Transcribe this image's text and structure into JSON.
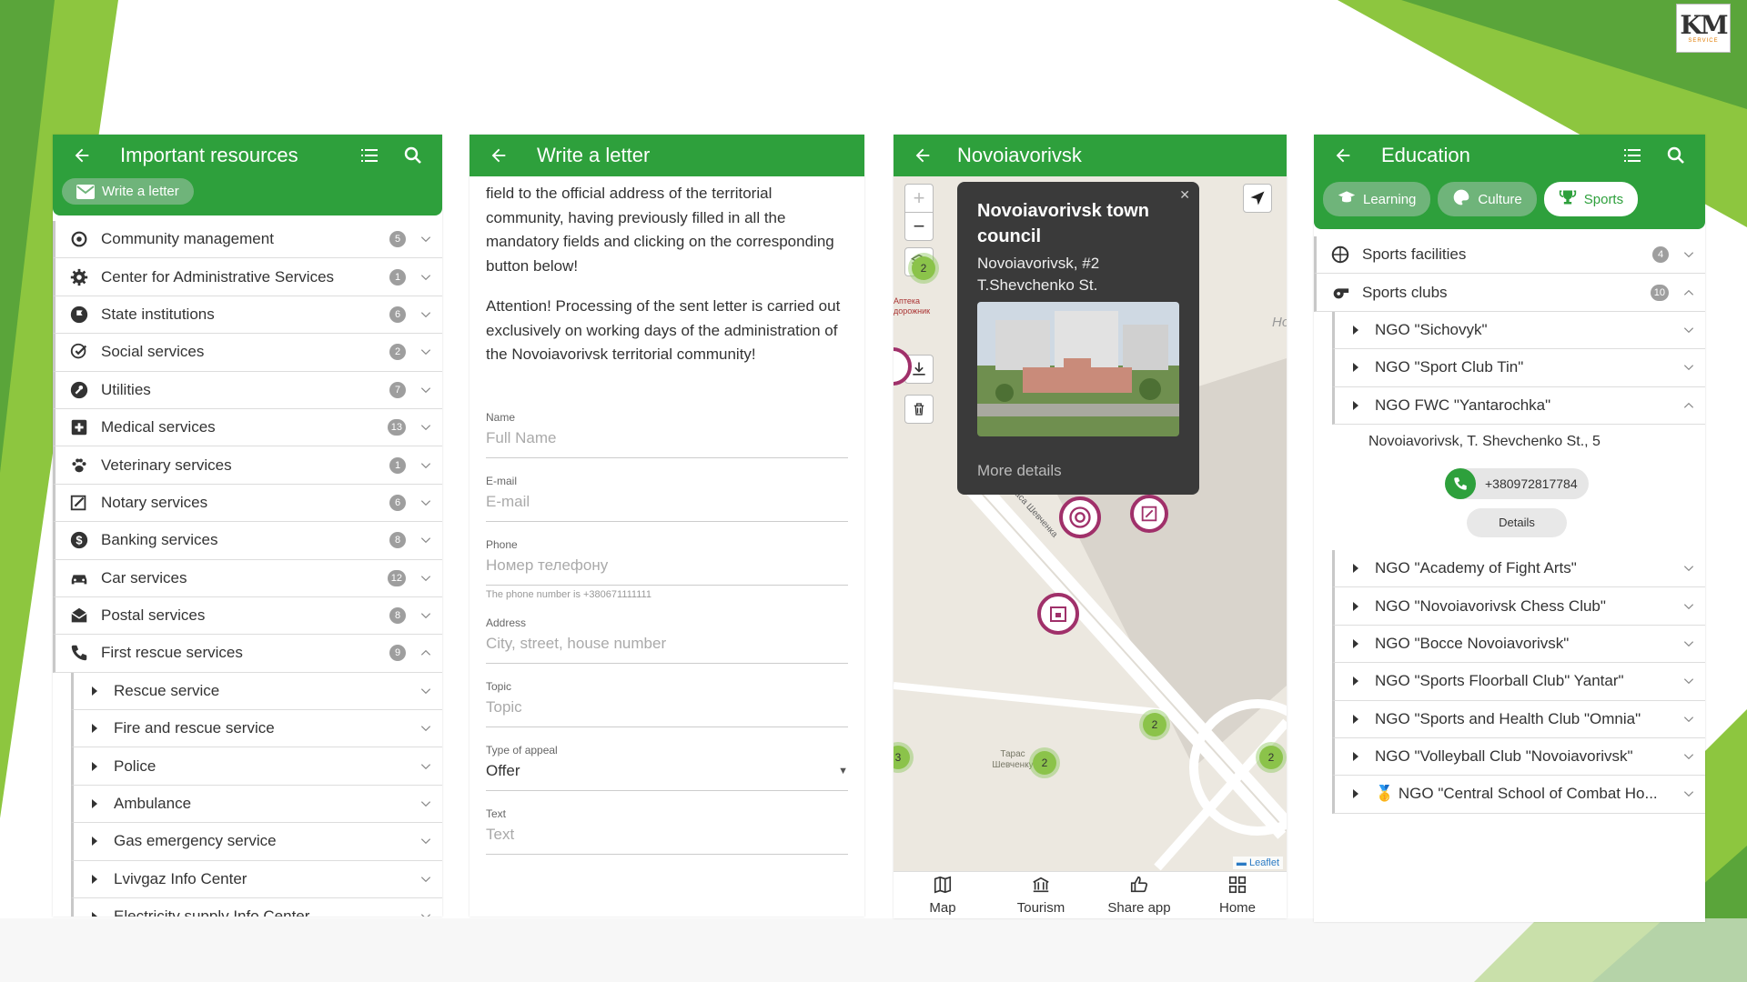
{
  "colors": {
    "brand_green": "#2ea03c",
    "light_green": "#8dc63f",
    "map_pin": "#a0306a"
  },
  "logo": {
    "text": "KM",
    "sub": "SERVICE"
  },
  "panel1": {
    "title": "Important resources",
    "write_button": "Write a letter",
    "items": [
      {
        "label": "Community management",
        "count": "5",
        "icon": "community-icon"
      },
      {
        "label": "Center for Administrative Services",
        "count": "1",
        "icon": "gear-icon"
      },
      {
        "label": "State institutions",
        "count": "6",
        "icon": "flag-icon"
      },
      {
        "label": "Social services",
        "count": "2",
        "icon": "social-icon"
      },
      {
        "label": "Utilities",
        "count": "7",
        "icon": "wrench-icon"
      },
      {
        "label": "Medical services",
        "count": "13",
        "icon": "medical-cross-icon"
      },
      {
        "label": "Veterinary services",
        "count": "1",
        "icon": "paw-icon"
      },
      {
        "label": "Notary services",
        "count": "6",
        "icon": "notary-icon"
      },
      {
        "label": "Banking services",
        "count": "8",
        "icon": "dollar-icon"
      },
      {
        "label": "Car services",
        "count": "12",
        "icon": "car-icon"
      },
      {
        "label": "Postal services",
        "count": "8",
        "icon": "mail-icon"
      },
      {
        "label": "First rescue services",
        "count": "9",
        "icon": "phone-icon"
      }
    ],
    "subitems": [
      "Rescue service",
      "Fire and rescue service",
      "Police",
      "Ambulance",
      "Gas emergency service",
      "Lvivgaz Info Center"
    ],
    "cut_item": "Electricity supply Info Center"
  },
  "panel2": {
    "title": "Write a letter",
    "para1": "field to the official address of the territorial community, having previously filled in all the mandatory fields and clicking on the corresponding button below!",
    "para2": "Attention! Processing of the sent letter is carried out exclusively on working days of the administration of the Novoiavorivsk territorial community!",
    "fields": {
      "name_label": "Name",
      "name_ph": "Full Name",
      "email_label": "E-mail",
      "email_ph": "E-mail",
      "phone_label": "Phone",
      "phone_ph": "Номер телефону",
      "phone_hint": "The phone number is +380671111111",
      "address_label": "Address",
      "address_ph": "City, street, house number",
      "topic_label": "Topic",
      "topic_ph": "Topic",
      "type_label": "Type of appeal",
      "type_value": "Offer",
      "text_label": "Text",
      "text_ph": "Text"
    }
  },
  "panel3": {
    "title": "Novoiavorivsk",
    "popup": {
      "title": "Novoiavorivsk town council",
      "address": "Novoiavorivsk, #2 T.Shevchenko St.",
      "more": "More details"
    },
    "clusters": [
      "2",
      "2",
      "2",
      "3",
      "2"
    ],
    "street": "Тараса Шевченка",
    "place_label": "Тарас Шевченку",
    "map_text_left": "Аптека дорожник",
    "map_text_right": "Но",
    "attribution": "Leaflet",
    "nav": [
      {
        "label": "Map",
        "icon": "map-icon"
      },
      {
        "label": "Tourism",
        "icon": "museum-icon"
      },
      {
        "label": "Share app",
        "icon": "thumbs-up-icon"
      },
      {
        "label": "Home",
        "icon": "grid-icon"
      }
    ]
  },
  "panel4": {
    "title": "Education",
    "tabs": [
      {
        "label": "Learning",
        "icon": "graduation-cap-icon"
      },
      {
        "label": "Culture",
        "icon": "palette-icon"
      },
      {
        "label": "Sports",
        "icon": "trophy-icon"
      }
    ],
    "categories": [
      {
        "label": "Sports facilities",
        "count": "4"
      },
      {
        "label": "Sports clubs",
        "count": "10"
      }
    ],
    "clubs_before": [
      "NGO \"Sichovyk\"",
      "NGO \"Sport Club Tin\"",
      "NGO FWC \"Yantarochka\""
    ],
    "detail": {
      "address": "Novoiavorivsk, T. Shevchenko St., 5",
      "phone": "+380972817784",
      "details_button": "Details"
    },
    "clubs_after": [
      "NGO \"Academy of Fight Arts\"",
      "NGO \"Novoiavorivsk Chess Club\"",
      "NGO \"Bocce Novoiavorivsk\"",
      "NGO \"Sports Floorball Club\" Yantar\"",
      "NGO \"Sports and Health Club \"Omnia\"",
      "NGO \"Volleyball Club \"Novoiavorivsk\"",
      "🥇 NGO \"Central School of Combat Ho..."
    ]
  }
}
